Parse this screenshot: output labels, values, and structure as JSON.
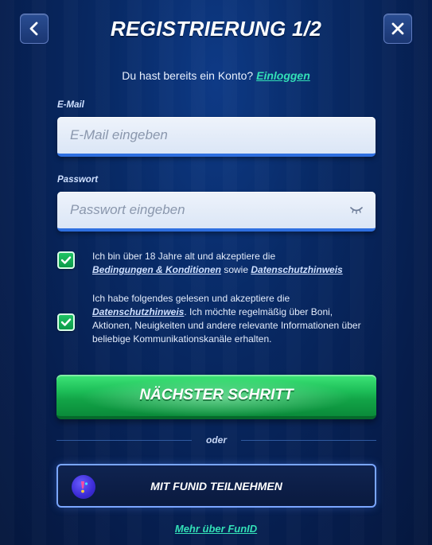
{
  "header": {
    "title": "REGISTRIERUNG 1/2",
    "back_icon": "chevron-left-icon",
    "close_icon": "close-icon"
  },
  "login_prompt": {
    "text": "Du hast bereits ein Konto?",
    "link": "Einloggen"
  },
  "email": {
    "label": "E-Mail",
    "placeholder": "E-Mail eingeben",
    "value": ""
  },
  "password": {
    "label": "Passwort",
    "placeholder": "Passwort eingeben",
    "value": "",
    "toggle_icon": "eye-closed-icon"
  },
  "consent_age": {
    "checked": true,
    "text_before": "Ich bin über 18 Jahre alt und akzeptiere die",
    "link_terms": "Bedingungen & Konditionen",
    "text_middle": "sowie",
    "link_privacy": "Datenschutzhinweis"
  },
  "consent_marketing": {
    "checked": true,
    "text_before": "Ich habe folgendes gelesen und akzeptiere die",
    "link_privacy": "Datenschutzhinweis",
    "text_after": ". Ich möchte regelmäßig über Boni, Aktionen, Neuigkeiten und andere relevante Informationen über beliebige Kommunikationskanäle erhalten."
  },
  "next_button": {
    "label": "NÄCHSTER SCHRITT"
  },
  "divider": {
    "label": "oder"
  },
  "funid_button": {
    "label": "MIT FUNID TEILNEHMEN",
    "icon": "funid-logo-icon"
  },
  "funid_more": {
    "label": "Mehr über FunID"
  },
  "colors": {
    "accent_link": "#33e0b7",
    "primary_button": "#1dbd58",
    "background": "#082a66",
    "input_underline": "#2e6fe0"
  }
}
